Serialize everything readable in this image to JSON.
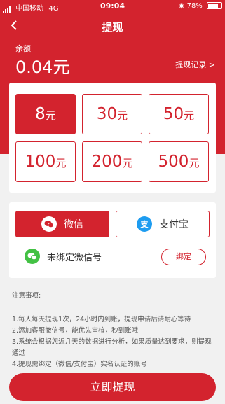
{
  "status_bar": {
    "carrier": "中国移动",
    "network": "4G",
    "time": "09:04",
    "battery": "78%",
    "battery_level": 0.78
  },
  "header": {
    "title": "提现",
    "balance_label": "余额",
    "balance": "0.04元",
    "record_link": "提现记录 >"
  },
  "amounts": [
    {
      "value": "8",
      "unit": "元",
      "selected": true
    },
    {
      "value": "30",
      "unit": "元",
      "selected": false
    },
    {
      "value": "50",
      "unit": "元",
      "selected": false
    },
    {
      "value": "100",
      "unit": "元",
      "selected": false
    },
    {
      "value": "200",
      "unit": "元",
      "selected": false
    },
    {
      "value": "500",
      "unit": "元",
      "selected": false
    }
  ],
  "payment": {
    "wechat_label": "微信",
    "alipay_label": "支付宝",
    "unbound_text": "未绑定微信号",
    "bind_button": "绑定",
    "selected": "wechat",
    "colors": {
      "accent": "#d3232e",
      "wechat_green": "#43c144",
      "alipay_blue": "#1d9cf0"
    }
  },
  "notes": {
    "title": "注意事项:",
    "items": [
      "1.每人每天提现1次，24小时内到账，提现申请后请耐心等待",
      "2.添加客服微信号，能优先审核，秒到账哦",
      "3.系统会根据您近几天的数据进行分析，如果质量达到要求，则提现通过",
      "4.提现需绑定（微信/支付宝）实名认证的账号"
    ]
  },
  "submit_label": "立即提现"
}
